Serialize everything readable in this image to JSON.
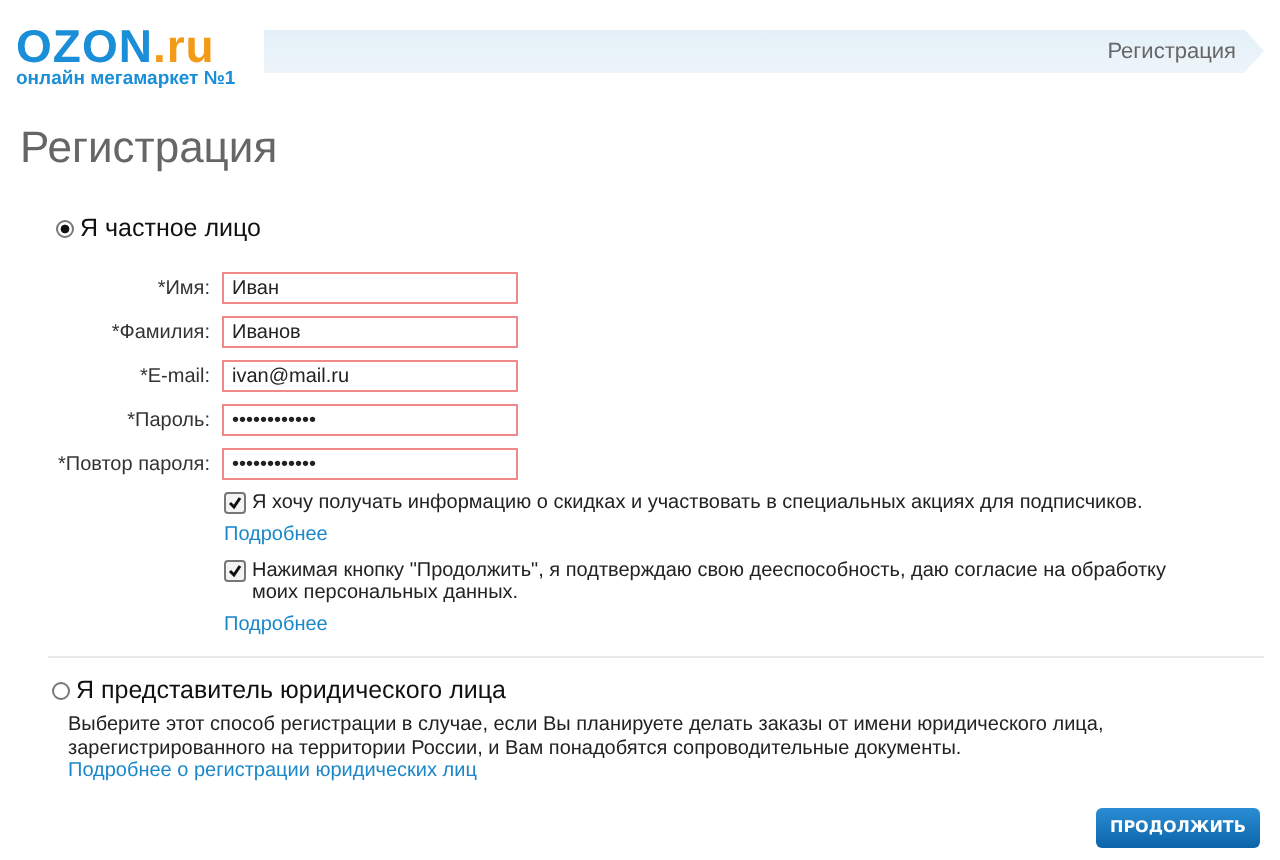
{
  "logo": {
    "name": "OZON",
    "domain": ".ru",
    "tagline": "онлайн мегамаркет №1"
  },
  "breadcrumb": "Регистрация",
  "title": "Регистрация",
  "person_option": {
    "label": "Я частное лицо",
    "selected": true
  },
  "fields": [
    {
      "label": "*Имя:",
      "value": "Иван"
    },
    {
      "label": "*Фамилия:",
      "value": "Иванов"
    },
    {
      "label": "*E-mail:",
      "value": "ivan@mail.ru"
    },
    {
      "label": "*Пароль:",
      "value": "••••••••••••"
    },
    {
      "label": "*Повтор пароля:",
      "value": "••••••••••••"
    }
  ],
  "agreements": [
    {
      "text": "Я хочу получать информацию о скидках и участвовать в специальных акциях для подписчиков.",
      "checked": true,
      "link": "Подробнее"
    },
    {
      "text": "Нажимая кнопку \"Продолжить\", я подтверждаю свою дееспособность, даю согласие на обработку моих персональных данных.",
      "checked": true,
      "link": "Подробнее"
    }
  ],
  "company_option": {
    "label": "Я представитель юридического лица",
    "selected": false,
    "description": "Выберите этот способ регистрации в случае, если Вы планируете делать заказы от имени юридического лица, зарегистрированного на территории России, и Вам понадобятся сопроводительные документы.",
    "link": "Подробнее о регистрации юридических лиц"
  },
  "continue_button": "ПРОДОЛЖИТЬ"
}
